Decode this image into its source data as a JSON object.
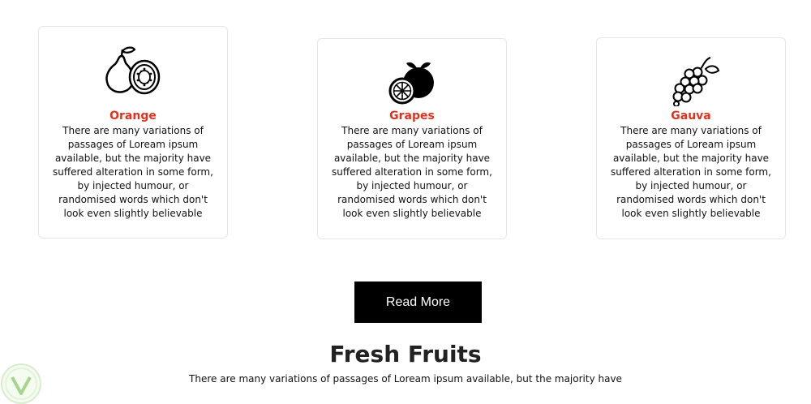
{
  "cards": [
    {
      "icon": "guava-icon",
      "title": "Orange",
      "text": "There are many variations of passages of Loream ipsum available, but the majority have suffered alteration in some form, by injected humour, or randomised words which don't look even slightly believable"
    },
    {
      "icon": "orange-icon",
      "title": "Grapes",
      "text": "There are many variations of passages of Loream ipsum available, but the majority have suffered alteration in some form, by injected humour, or randomised words which don't look even slightly believable"
    },
    {
      "icon": "grapes-icon",
      "title": "Gauva",
      "text": "There are many variations of passages of Loream ipsum available, but the majority have suffered alteration in some form, by injected humour, or randomised words which don't look even slightly believable"
    }
  ],
  "read_more_label": "Read More",
  "section": {
    "title": "Fresh Fruits",
    "subtitle": "There are many variations of passages of Loream ipsum available, but the majority have"
  },
  "colors": {
    "accent": "#e0321c",
    "button_bg": "#000000",
    "button_text": "#ffffff",
    "card_border": "#e6e6e6"
  },
  "badge_icon": "leaf-logo-icon"
}
